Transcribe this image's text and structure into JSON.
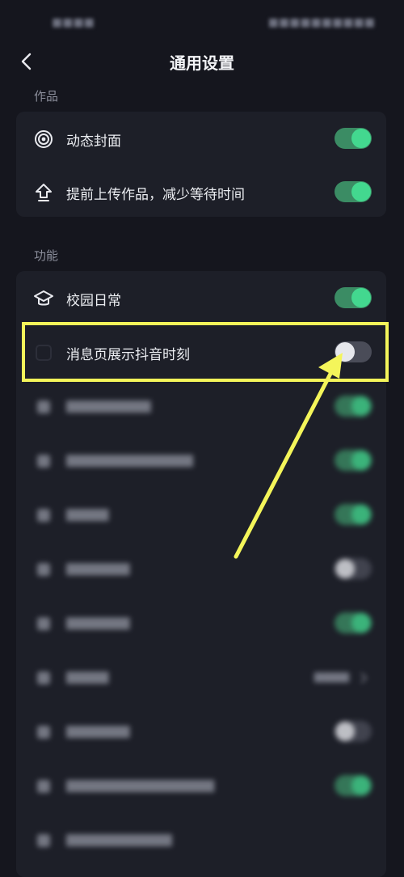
{
  "title": "通用设置",
  "sections": {
    "works": {
      "label": "作品",
      "items": [
        {
          "label": "动态封面",
          "icon": "target-icon",
          "toggle": true
        },
        {
          "label": "提前上传作品，减少等待时间",
          "icon": "upload-icon",
          "toggle": true
        }
      ]
    },
    "features": {
      "label": "功能",
      "items": [
        {
          "label": "校园日常",
          "icon": "graduation-cap-icon",
          "toggle": true
        },
        {
          "label": "消息页展示抖音时刻",
          "icon": "moment-icon",
          "toggle": false
        }
      ]
    }
  },
  "colors": {
    "background": "#15161e",
    "card": "#1d1f28",
    "toggle_on": "#43d88f",
    "highlight": "#f4f55a"
  }
}
